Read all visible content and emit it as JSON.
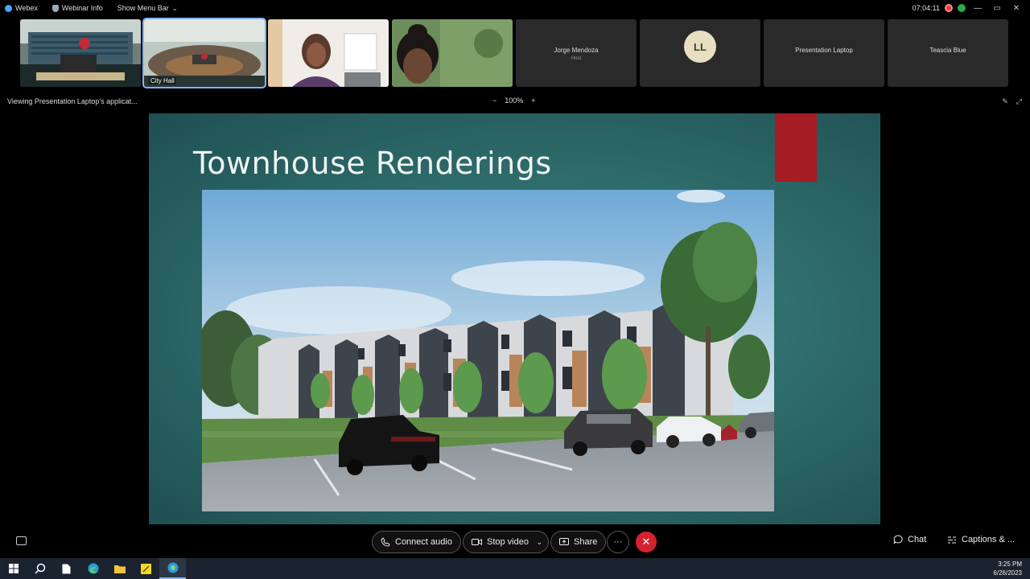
{
  "titlebar": {
    "app_name": "Webex",
    "webinar_info": "Webinar Info",
    "show_menu_bar": "Show Menu Bar",
    "timer": "07:04:11"
  },
  "participants": [
    {
      "label": ""
    },
    {
      "label": "City Hall"
    },
    {
      "label": ""
    },
    {
      "label": ""
    },
    {
      "name": "Jorge Mendoza",
      "subtitle": "Host"
    },
    {
      "initials": "LL"
    },
    {
      "name": "Presentation Laptop"
    },
    {
      "name": "Teascia Blue"
    }
  ],
  "viewing": {
    "text": "Viewing Presentation Laptop's applicat...",
    "zoom": "100%",
    "zoom_minus": "−",
    "zoom_plus": "+"
  },
  "slide": {
    "title": "Townhouse Renderings",
    "accent_color": "#a51c24"
  },
  "controls": {
    "connect_audio": "Connect audio",
    "stop_video": "Stop video",
    "share": "Share",
    "more": "···",
    "end": "✕",
    "chat": "Chat",
    "captions": "Captions & ..."
  },
  "taskbar": {
    "time": "3:25 PM",
    "date": "6/26/2023"
  }
}
